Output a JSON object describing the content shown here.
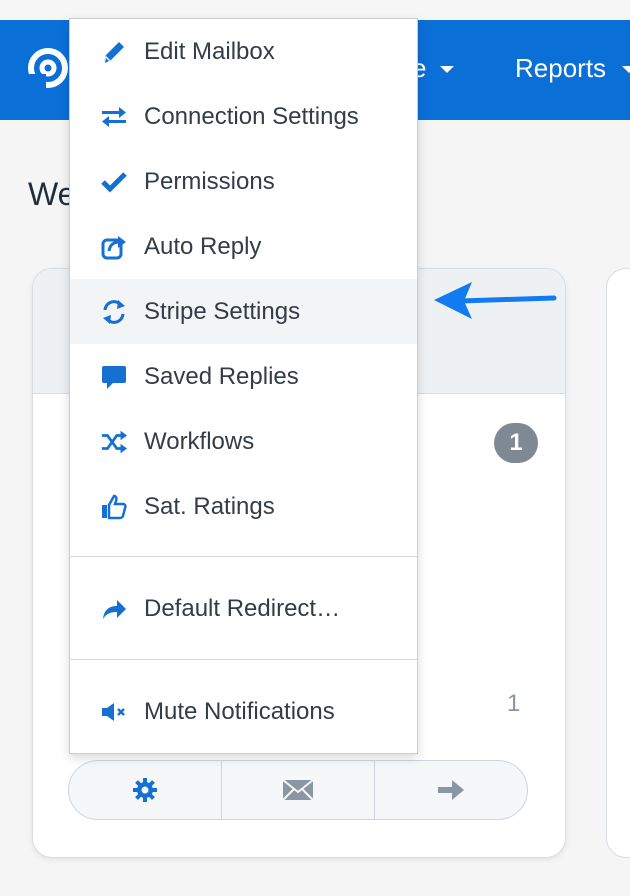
{
  "colors": {
    "brand": "#0b6fd8",
    "accent": "#1670d2",
    "arrow": "#137bf2",
    "badge": "#7e8994"
  },
  "navbar": {
    "partial_label": "e",
    "reports_label": "Reports"
  },
  "page": {
    "heading_partial": "We"
  },
  "card": {
    "badge_count": "1",
    "count_value": "1",
    "actions": [
      {
        "name": "settings",
        "icon": "gear-icon"
      },
      {
        "name": "email",
        "icon": "envelope-icon"
      },
      {
        "name": "open",
        "icon": "arrow-right-icon"
      }
    ]
  },
  "menu": {
    "items": [
      {
        "label": "Edit Mailbox",
        "icon": "pencil-icon"
      },
      {
        "label": "Connection Settings",
        "icon": "exchange-arrows-icon"
      },
      {
        "label": "Permissions",
        "icon": "checkmark-icon"
      },
      {
        "label": "Auto Reply",
        "icon": "share-box-icon"
      },
      {
        "label": "Stripe Settings",
        "icon": "refresh-icon"
      },
      {
        "label": "Saved Replies",
        "icon": "speech-bubble-icon"
      },
      {
        "label": "Workflows",
        "icon": "shuffle-icon"
      },
      {
        "label": "Sat. Ratings",
        "icon": "thumbs-up-icon"
      },
      {
        "label": "Default Redirect…",
        "icon": "redirect-arrow-icon"
      },
      {
        "label": "Mute Notifications",
        "icon": "mute-speaker-icon"
      }
    ],
    "highlighted": "Stripe Settings"
  }
}
